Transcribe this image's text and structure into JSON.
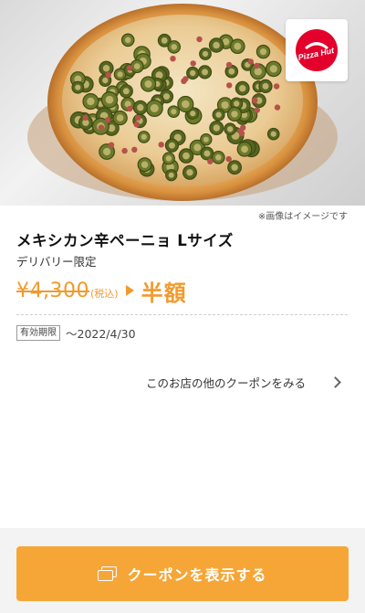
{
  "coupon": {
    "image_caption": "※画像はイメージです",
    "logo_text": "Pizza Hut",
    "product_name": "メキシカン辛ペーニョ Lサイズ",
    "delivery_note": "デリバリー限定",
    "original_price": "¥4,300",
    "tax_label": "(税込)",
    "discount_label": "半額",
    "validity_badge": "有効期限",
    "validity_date": "〜2022/4/30",
    "other_coupons_link": "このお店の他のクーポンをみる",
    "show_button_label": "クーポンを表示する"
  },
  "colors": {
    "accent": "#f6a637",
    "price": "#f19a2e",
    "logo_red": "#e3002b"
  },
  "icons": {
    "logo": "pizza-hut-logo",
    "arrow": "play-triangle-icon",
    "chevron": "chevron-right-icon",
    "coupon": "coupon-cards-icon"
  }
}
